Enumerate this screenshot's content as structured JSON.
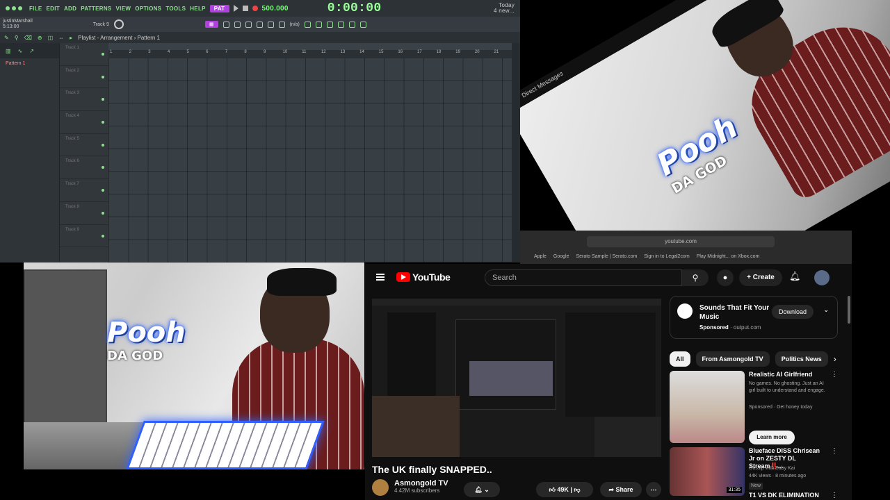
{
  "fl": {
    "menu": [
      "FILE",
      "EDIT",
      "ADD",
      "PATTERNS",
      "VIEW",
      "OPTIONS",
      "TOOLS",
      "HELP"
    ],
    "pattern": "PAT",
    "tempo": "500.000",
    "time": "0:00:00",
    "user": "justinMarshall",
    "user_time": "5:13:00",
    "track_label": "Track 9",
    "snap": "Line",
    "lines": "(n/a)",
    "playlist_title": "Playlist - Arrangement › Pattern 1",
    "pattern_item": "Pattern 1",
    "tracks": [
      "Track 1",
      "Track 2",
      "Track 3",
      "Track 4",
      "Track 5",
      "Track 6",
      "Track 7",
      "Track 8",
      "Track 9"
    ],
    "ruler": [
      "1",
      "2",
      "3",
      "4",
      "5",
      "6",
      "7",
      "8",
      "9",
      "10",
      "11",
      "12",
      "13",
      "14",
      "15",
      "16",
      "17",
      "18",
      "19",
      "20",
      "21"
    ],
    "top_right_1": "Today",
    "top_right_2": "4 new..."
  },
  "cam2": {
    "dm_label": "Direct Messages",
    "logo": "Pooh",
    "logo_sub": "DA GOD"
  },
  "cam1": {
    "logo": "Pooh",
    "logo_sub": "DA GOD"
  },
  "browser": {
    "url": "youtube.com",
    "bookmarks": [
      "Apple",
      "Google",
      "Serato Sample | Serato.com",
      "Sign in to Legal2com",
      "Play Midnight... on Xbox.com"
    ]
  },
  "youtube": {
    "logo_text": "YouTube",
    "search_placeholder": "Search",
    "create_label": "Create",
    "video_title": "The UK finally SNAPPED..",
    "channel_name": "Asmongold TV",
    "subscribers": "4.42M subscribers",
    "likes": "49K",
    "share_label": "Share",
    "ad_title": "Sounds That Fit Your Music",
    "ad_sponsored": "Sponsored",
    "ad_domain": "output.com",
    "ad_download": "Download",
    "chips": [
      "All",
      "From Asmongold TV",
      "Politics News"
    ],
    "recs": [
      {
        "title": "Realistic AI Girlfriend",
        "desc": "No games. No ghosting. Just an AI girl built to understand and engage.",
        "meta": "Sponsored · Get honey today",
        "button": "Learn more"
      },
      {
        "title": "Blueface DISS Chrisean Jr on ZESTY DL Stream‼️...",
        "channel": "Gossip with Baby Kai",
        "meta": "44K views · 8 minutes ago",
        "badge": "New",
        "duration": "31:35"
      },
      {
        "title": "T1 VS DK ELIMINATION"
      }
    ]
  },
  "colors": {
    "fl_accent": "#8fe08f",
    "fl_bg": "#3b4247",
    "yt_bg": "#0f0f0f",
    "yt_red": "#ff0000"
  }
}
